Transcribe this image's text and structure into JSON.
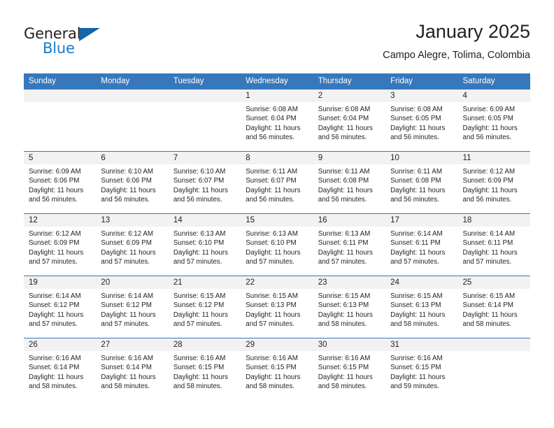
{
  "brand": {
    "logo_text_top": "General",
    "logo_text_bottom": "Blue",
    "logo_icon": "flag-triangle-icon",
    "accent_color": "#1a7ac4",
    "header_color": "#3778bc"
  },
  "header": {
    "title": "January 2025",
    "subtitle": "Campo Alegre, Tolima, Colombia"
  },
  "weekday_headers": [
    "Sunday",
    "Monday",
    "Tuesday",
    "Wednesday",
    "Thursday",
    "Friday",
    "Saturday"
  ],
  "weeks": [
    [
      {
        "day": "",
        "lines": []
      },
      {
        "day": "",
        "lines": []
      },
      {
        "day": "",
        "lines": []
      },
      {
        "day": "1",
        "lines": [
          "Sunrise: 6:08 AM",
          "Sunset: 6:04 PM",
          "Daylight: 11 hours",
          "and 56 minutes."
        ]
      },
      {
        "day": "2",
        "lines": [
          "Sunrise: 6:08 AM",
          "Sunset: 6:04 PM",
          "Daylight: 11 hours",
          "and 56 minutes."
        ]
      },
      {
        "day": "3",
        "lines": [
          "Sunrise: 6:08 AM",
          "Sunset: 6:05 PM",
          "Daylight: 11 hours",
          "and 56 minutes."
        ]
      },
      {
        "day": "4",
        "lines": [
          "Sunrise: 6:09 AM",
          "Sunset: 6:05 PM",
          "Daylight: 11 hours",
          "and 56 minutes."
        ]
      }
    ],
    [
      {
        "day": "5",
        "lines": [
          "Sunrise: 6:09 AM",
          "Sunset: 6:06 PM",
          "Daylight: 11 hours",
          "and 56 minutes."
        ]
      },
      {
        "day": "6",
        "lines": [
          "Sunrise: 6:10 AM",
          "Sunset: 6:06 PM",
          "Daylight: 11 hours",
          "and 56 minutes."
        ]
      },
      {
        "day": "7",
        "lines": [
          "Sunrise: 6:10 AM",
          "Sunset: 6:07 PM",
          "Daylight: 11 hours",
          "and 56 minutes."
        ]
      },
      {
        "day": "8",
        "lines": [
          "Sunrise: 6:11 AM",
          "Sunset: 6:07 PM",
          "Daylight: 11 hours",
          "and 56 minutes."
        ]
      },
      {
        "day": "9",
        "lines": [
          "Sunrise: 6:11 AM",
          "Sunset: 6:08 PM",
          "Daylight: 11 hours",
          "and 56 minutes."
        ]
      },
      {
        "day": "10",
        "lines": [
          "Sunrise: 6:11 AM",
          "Sunset: 6:08 PM",
          "Daylight: 11 hours",
          "and 56 minutes."
        ]
      },
      {
        "day": "11",
        "lines": [
          "Sunrise: 6:12 AM",
          "Sunset: 6:09 PM",
          "Daylight: 11 hours",
          "and 56 minutes."
        ]
      }
    ],
    [
      {
        "day": "12",
        "lines": [
          "Sunrise: 6:12 AM",
          "Sunset: 6:09 PM",
          "Daylight: 11 hours",
          "and 57 minutes."
        ]
      },
      {
        "day": "13",
        "lines": [
          "Sunrise: 6:12 AM",
          "Sunset: 6:09 PM",
          "Daylight: 11 hours",
          "and 57 minutes."
        ]
      },
      {
        "day": "14",
        "lines": [
          "Sunrise: 6:13 AM",
          "Sunset: 6:10 PM",
          "Daylight: 11 hours",
          "and 57 minutes."
        ]
      },
      {
        "day": "15",
        "lines": [
          "Sunrise: 6:13 AM",
          "Sunset: 6:10 PM",
          "Daylight: 11 hours",
          "and 57 minutes."
        ]
      },
      {
        "day": "16",
        "lines": [
          "Sunrise: 6:13 AM",
          "Sunset: 6:11 PM",
          "Daylight: 11 hours",
          "and 57 minutes."
        ]
      },
      {
        "day": "17",
        "lines": [
          "Sunrise: 6:14 AM",
          "Sunset: 6:11 PM",
          "Daylight: 11 hours",
          "and 57 minutes."
        ]
      },
      {
        "day": "18",
        "lines": [
          "Sunrise: 6:14 AM",
          "Sunset: 6:11 PM",
          "Daylight: 11 hours",
          "and 57 minutes."
        ]
      }
    ],
    [
      {
        "day": "19",
        "lines": [
          "Sunrise: 6:14 AM",
          "Sunset: 6:12 PM",
          "Daylight: 11 hours",
          "and 57 minutes."
        ]
      },
      {
        "day": "20",
        "lines": [
          "Sunrise: 6:14 AM",
          "Sunset: 6:12 PM",
          "Daylight: 11 hours",
          "and 57 minutes."
        ]
      },
      {
        "day": "21",
        "lines": [
          "Sunrise: 6:15 AM",
          "Sunset: 6:12 PM",
          "Daylight: 11 hours",
          "and 57 minutes."
        ]
      },
      {
        "day": "22",
        "lines": [
          "Sunrise: 6:15 AM",
          "Sunset: 6:13 PM",
          "Daylight: 11 hours",
          "and 57 minutes."
        ]
      },
      {
        "day": "23",
        "lines": [
          "Sunrise: 6:15 AM",
          "Sunset: 6:13 PM",
          "Daylight: 11 hours",
          "and 58 minutes."
        ]
      },
      {
        "day": "24",
        "lines": [
          "Sunrise: 6:15 AM",
          "Sunset: 6:13 PM",
          "Daylight: 11 hours",
          "and 58 minutes."
        ]
      },
      {
        "day": "25",
        "lines": [
          "Sunrise: 6:15 AM",
          "Sunset: 6:14 PM",
          "Daylight: 11 hours",
          "and 58 minutes."
        ]
      }
    ],
    [
      {
        "day": "26",
        "lines": [
          "Sunrise: 6:16 AM",
          "Sunset: 6:14 PM",
          "Daylight: 11 hours",
          "and 58 minutes."
        ]
      },
      {
        "day": "27",
        "lines": [
          "Sunrise: 6:16 AM",
          "Sunset: 6:14 PM",
          "Daylight: 11 hours",
          "and 58 minutes."
        ]
      },
      {
        "day": "28",
        "lines": [
          "Sunrise: 6:16 AM",
          "Sunset: 6:15 PM",
          "Daylight: 11 hours",
          "and 58 minutes."
        ]
      },
      {
        "day": "29",
        "lines": [
          "Sunrise: 6:16 AM",
          "Sunset: 6:15 PM",
          "Daylight: 11 hours",
          "and 58 minutes."
        ]
      },
      {
        "day": "30",
        "lines": [
          "Sunrise: 6:16 AM",
          "Sunset: 6:15 PM",
          "Daylight: 11 hours",
          "and 58 minutes."
        ]
      },
      {
        "day": "31",
        "lines": [
          "Sunrise: 6:16 AM",
          "Sunset: 6:15 PM",
          "Daylight: 11 hours",
          "and 59 minutes."
        ]
      },
      {
        "day": "",
        "lines": []
      }
    ]
  ]
}
